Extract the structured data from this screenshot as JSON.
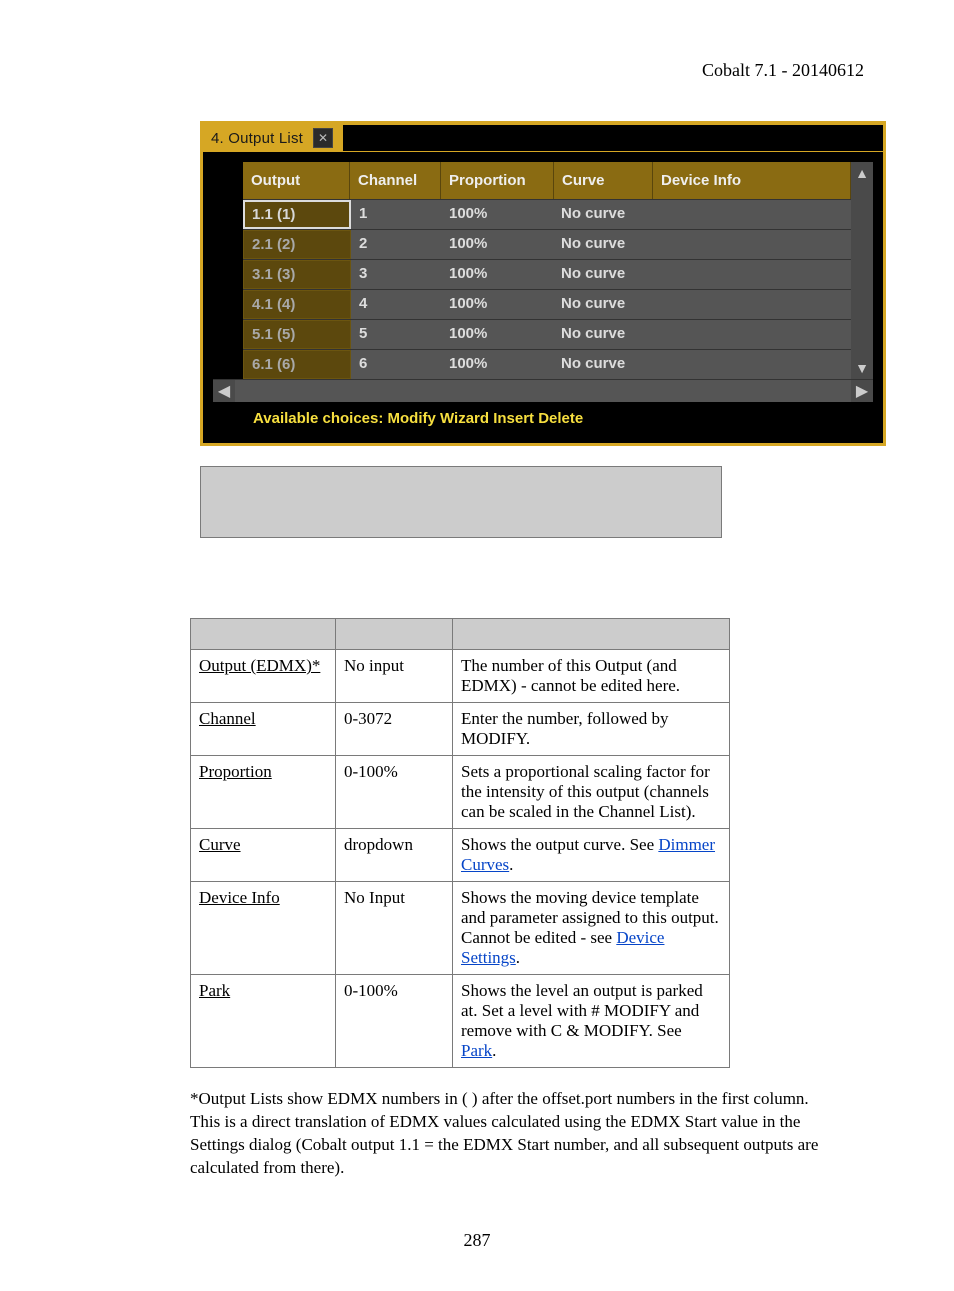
{
  "header": {
    "version": "Cobalt 7.1 - 20140612"
  },
  "app": {
    "title": "4. Output List",
    "columns": {
      "output": "Output",
      "channel": "Channel",
      "proportion": "Proportion",
      "curve": "Curve",
      "device": "Device Info"
    },
    "rows": [
      {
        "output": "1.1 (1)",
        "channel": "1",
        "proportion": "100%",
        "curve": "No curve",
        "device": "",
        "selected": true
      },
      {
        "output": "2.1 (2)",
        "channel": "2",
        "proportion": "100%",
        "curve": "No curve",
        "device": ""
      },
      {
        "output": "3.1 (3)",
        "channel": "3",
        "proportion": "100%",
        "curve": "No curve",
        "device": ""
      },
      {
        "output": "4.1 (4)",
        "channel": "4",
        "proportion": "100%",
        "curve": "No curve",
        "device": ""
      },
      {
        "output": "5.1 (5)",
        "channel": "5",
        "proportion": "100%",
        "curve": "No curve",
        "device": ""
      },
      {
        "output": "6.1 (6)",
        "channel": "6",
        "proportion": "100%",
        "curve": "No curve",
        "device": ""
      }
    ],
    "footer": "Available choices: Modify Wizard Insert Delete"
  },
  "desc": {
    "rows": [
      {
        "name": "Output (EDMX)*",
        "input": "No input",
        "text": "The number of this Output (and EDMX) - cannot be edited here."
      },
      {
        "name": "Channel",
        "input": "0-3072",
        "text": "Enter the number, followed by MODIFY."
      },
      {
        "name": "Proportion",
        "input": "0-100%",
        "text": "Sets a proportional scaling factor for the intensity of this output (channels can be scaled in the Channel List)."
      },
      {
        "name": "Curve",
        "input": "dropdown",
        "pre": "Shows the output curve. See ",
        "link": "Dimmer Curves",
        "post": "."
      },
      {
        "name": "Device Info",
        "input": "No Input",
        "pre": "Shows the moving device template and parameter assigned to this output. Cannot be edited - see ",
        "link": "Device Settings",
        "post": "."
      },
      {
        "name": "Park",
        "input": "0-100%",
        "pre": "Shows the level an output is parked at. Set a level with # MODIFY and remove with C & MODIFY. See ",
        "link": "Park",
        "post": "."
      }
    ]
  },
  "footnote": "*Output Lists show EDMX numbers in ( ) after the offset.port numbers in the first column. This is a direct translation of EDMX values calculated using the EDMX Start value in the Settings dialog (Cobalt output 1.1 = the EDMX Start number, and all subsequent outputs are calculated from there).",
  "page_number": "287"
}
